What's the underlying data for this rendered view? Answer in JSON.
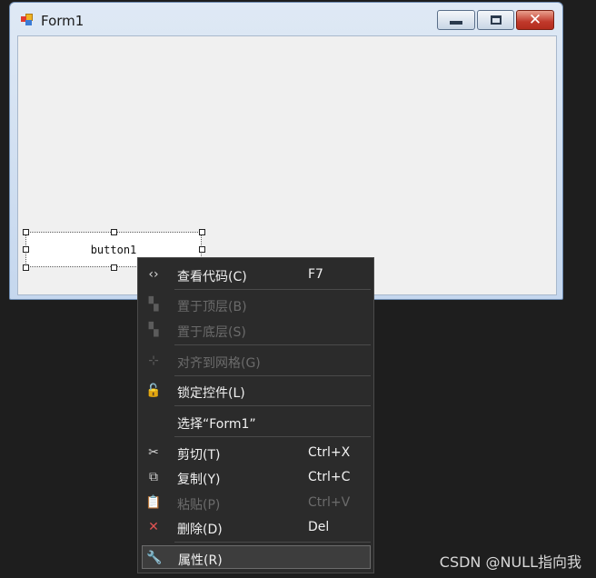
{
  "window": {
    "title": "Form1",
    "controls": {
      "minimize": "",
      "maximize": "",
      "close": "✕"
    }
  },
  "designer": {
    "selected_button_text": "button1"
  },
  "context_menu": {
    "items": [
      {
        "label": "查看代码(C)",
        "shortcut": "F7",
        "icon": "code-icon",
        "glyph": "‹›",
        "enabled": true
      },
      {
        "label": "置于顶层(B)",
        "shortcut": "",
        "icon": "bring-to-front-icon",
        "glyph": "▚",
        "enabled": false
      },
      {
        "label": "置于底层(S)",
        "shortcut": "",
        "icon": "send-to-back-icon",
        "glyph": "▚",
        "enabled": false
      },
      {
        "label": "对齐到网格(G)",
        "shortcut": "",
        "icon": "align-to-grid-icon",
        "glyph": "⊹",
        "enabled": false
      },
      {
        "label": "锁定控件(L)",
        "shortcut": "",
        "icon": "lock-icon",
        "glyph": "🔓",
        "enabled": true
      },
      {
        "label": "选择“Form1”",
        "shortcut": "",
        "icon": "",
        "glyph": "",
        "enabled": true
      },
      {
        "label": "剪切(T)",
        "shortcut": "Ctrl+X",
        "icon": "scissors-icon",
        "glyph": "✂",
        "enabled": true
      },
      {
        "label": "复制(Y)",
        "shortcut": "Ctrl+C",
        "icon": "copy-icon",
        "glyph": "⧉",
        "enabled": true
      },
      {
        "label": "粘贴(P)",
        "shortcut": "Ctrl+V",
        "icon": "paste-icon",
        "glyph": "📋",
        "enabled": false
      },
      {
        "label": "删除(D)",
        "shortcut": "Del",
        "icon": "delete-icon",
        "glyph": "✕",
        "enabled": true
      },
      {
        "label": "属性(R)",
        "shortcut": "",
        "icon": "wrench-icon",
        "glyph": "🔧",
        "enabled": true,
        "highlighted": true
      }
    ]
  },
  "colors": {
    "menu_background": "#2b2b2b",
    "delete_icon": "#e05252",
    "page_background": "#1e1e1e"
  },
  "watermark": "CSDN @NULL指向我"
}
